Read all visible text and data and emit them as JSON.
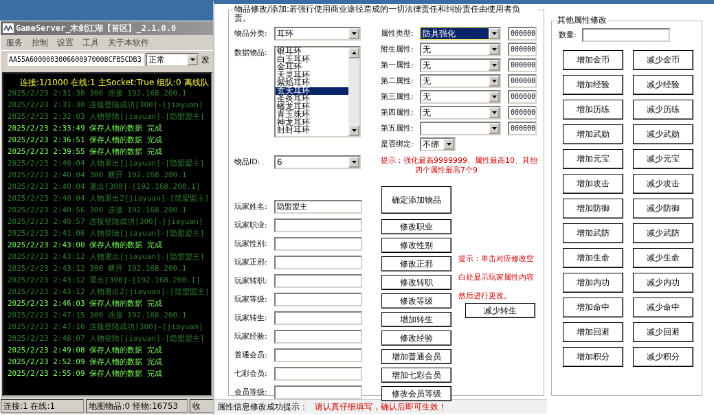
{
  "server_window": {
    "title": "GameServer_木剑江湖【首区】_2.1.0.0",
    "menu": [
      "服务",
      "控制",
      "设置",
      "工具",
      "关于本软件"
    ],
    "command": {
      "value": "AA55A6000003006600970008CFB5CDB3",
      "mode": "正常",
      "send": "发"
    },
    "summary": "连接:1/1000 在线:1 主Socket:True 组队:0 离线队",
    "log": [
      {
        "time": "2025/2/23  2:31:30",
        "text": "300 连接 192.168.200.1",
        "highlight": false
      },
      {
        "time": "2025/2/23  2:31:30",
        "text": "连接登陆成功[300]-[jiayuan]",
        "highlight": false
      },
      {
        "time": "2025/2/23  2:32:03",
        "text": "人物登陆[jiayuan]-[隐盟盟主]",
        "highlight": false
      },
      {
        "time": "2025/2/23  2:33:49",
        "text": "保存人物的数据 完成",
        "highlight": true
      },
      {
        "time": "2025/2/23  2:36:51",
        "text": "保存人物的数据 完成",
        "highlight": true
      },
      {
        "time": "2025/2/23  2:39:55",
        "text": "保存人物的数据 完成",
        "highlight": true
      },
      {
        "time": "2025/2/23  2:40:04",
        "text": "人物退出[jiayuan]-[隐盟盟主]",
        "highlight": false
      },
      {
        "time": "2025/2/23  2:40:04",
        "text": "300 断开 192.168.200.1",
        "highlight": false
      },
      {
        "time": "2025/2/23  2:40:04",
        "text": "退出[300]-[192.168.200.1]",
        "highlight": false
      },
      {
        "time": "2025/2/23  2:40:04",
        "text": "人物退出2[jiayuan]-[隐盟盟主]",
        "highlight": false
      },
      {
        "time": "2025/2/23  2:40:56",
        "text": "300 连接 192.168.200.1",
        "highlight": false
      },
      {
        "time": "2025/2/23  2:40:57",
        "text": "连接登陆成功[300]-[jiayuan]",
        "highlight": false
      },
      {
        "time": "2025/2/23  2:41:06",
        "text": "人物登陆[jiayuan]-[隐盟盟主]",
        "highlight": false
      },
      {
        "time": "2025/2/23  2:43:00",
        "text": "保存人物的数据 完成",
        "highlight": true
      },
      {
        "time": "2025/2/23  2:43:12",
        "text": "人物退出[jiayuan]-[隐盟盟主]",
        "highlight": false
      },
      {
        "time": "2025/2/23  2:43:12",
        "text": "300 断开 192.168.200.1",
        "highlight": false
      },
      {
        "time": "2025/2/23  2:43:12",
        "text": "退出[300]-[192.168.200.1]",
        "highlight": false
      },
      {
        "time": "2025/2/23  2:43:12",
        "text": "人物退出2[jiayuan]-[隐盟盟主]",
        "highlight": false
      },
      {
        "time": "2025/2/23  2:46:03",
        "text": "保存人物的数据 完成",
        "highlight": true
      },
      {
        "time": "2025/2/23  2:47:15",
        "text": "300 连接 192.168.200.1",
        "highlight": false
      },
      {
        "time": "2025/2/23  2:47:16",
        "text": "连接登陆成功[300]-[jiayuan]",
        "highlight": false
      },
      {
        "time": "2025/2/23  2:48:07",
        "text": "人物登陆[jiayuan]-[隐盟盟主]",
        "highlight": false
      },
      {
        "time": "2025/2/23  2:49:08",
        "text": "保存人物的数据 完成",
        "highlight": true
      },
      {
        "time": "2025/2/23  2:52:09",
        "text": "保存人物的数据 完成",
        "highlight": true
      },
      {
        "time": "2025/2/23  2:55:09",
        "text": "保存人物的数据 完成",
        "highlight": true
      }
    ],
    "status_bar": [
      "连接:1 在线:1",
      "地图物品:0 怪物:16753",
      "收"
    ]
  },
  "editor": {
    "group_title": "物品修改/添加:若强行使用商业途径造成的一切法律责任和纠纷责任由使用者负责。",
    "category": {
      "label": "物品分类:",
      "value": "耳环"
    },
    "items": {
      "label": "数据物品:",
      "list": [
        {
          "name": "银耳环",
          "selected": false
        },
        {
          "name": "白玉耳环",
          "selected": false
        },
        {
          "name": "金耳环",
          "selected": false
        },
        {
          "name": "天灵耳环",
          "selected": false
        },
        {
          "name": "紫焰耳环",
          "selected": false
        },
        {
          "name": "玄天耳环",
          "selected": true
        },
        {
          "name": "圣炎耳环",
          "selected": false
        },
        {
          "name": "蟠龙耳环",
          "selected": false
        },
        {
          "name": "青玉珠环",
          "selected": false
        },
        {
          "name": "神龙耳环",
          "selected": false
        },
        {
          "name": "封封耳环",
          "selected": false
        }
      ]
    },
    "item_id": {
      "label": "物品ID:",
      "value": "6"
    },
    "attributes": [
      {
        "label": "属性类型:",
        "value": "防具强化",
        "code": "000000",
        "selected": true
      },
      {
        "label": "附生属性:",
        "value": "无",
        "code": "000000",
        "selected": false
      },
      {
        "label": "第一属性:",
        "value": "无",
        "code": "000000",
        "selected": false
      },
      {
        "label": "第二属性:",
        "value": "无",
        "code": "000000",
        "selected": false
      },
      {
        "label": "第三属性:",
        "value": "无",
        "code": "000000",
        "selected": false
      },
      {
        "label": "第四属性:",
        "value": "无",
        "code": "000000",
        "selected": false
      },
      {
        "label": "第五属性:",
        "code": "000000",
        "selected": false
      }
    ],
    "bind": {
      "label": "是否绑定:",
      "value": "不绑"
    },
    "hint": [
      "提示：强化最高9999999、属性最高10、其他",
      "四个属性最高7个9"
    ],
    "add_button": "确定添加物品",
    "player": [
      {
        "label": "玩家姓名:",
        "value": "隐盟盟主"
      },
      {
        "label": "玩家职业:",
        "button": "修改职业"
      },
      {
        "label": "玩家性别:",
        "button": "修改性别"
      },
      {
        "label": "玩家正邪:",
        "button": "修改正邪"
      },
      {
        "label": "玩家转职:",
        "button": "修改转职"
      },
      {
        "label": "玩家等级:",
        "button": "修改等级"
      },
      {
        "label": "玩家转生:",
        "button": "增加转生"
      },
      {
        "label": "玩家经验:",
        "button": "修改经验"
      },
      {
        "label": "普通会员:",
        "button": "增加普通会员"
      },
      {
        "label": "七彩会员:",
        "button": "增加七彩会员"
      },
      {
        "label": "会员等级:",
        "button": "修改会员等级"
      }
    ],
    "side_hint": [
      "提示：单击对应修改空",
      "白处显示玩家属性内容",
      "然后进行更改。"
    ],
    "reduce_rebirth_button": "减少转生"
  },
  "other": {
    "title": "其他属性修改",
    "quantity_label": "数量:",
    "buttons": [
      [
        "增加金币",
        "减少金币"
      ],
      [
        "增加经验",
        "减少经验"
      ],
      [
        "增加历练",
        "减少历练"
      ],
      [
        "增加武勋",
        "减少武勋"
      ],
      [
        "增加元宝",
        "减少元宝"
      ],
      [
        "增加攻击",
        "减少攻击"
      ],
      [
        "增加防御",
        "减少防御"
      ],
      [
        "增加武防",
        "减少武防"
      ],
      [
        "增加生命",
        "减少生命"
      ],
      [
        "增加内功",
        "减少内功"
      ],
      [
        "增加命中",
        "减少命中"
      ],
      [
        "增加回避",
        "减少回避"
      ],
      [
        "增加积分",
        "减少积分"
      ]
    ]
  },
  "status": {
    "label": "属性信息修改成功提示：",
    "message": "请认真仔细填写，确认后即可生效！"
  }
}
